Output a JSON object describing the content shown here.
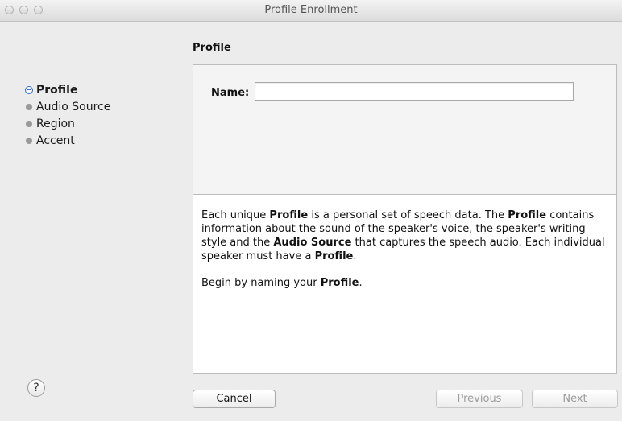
{
  "window": {
    "title": "Profile Enrollment"
  },
  "sidebar": {
    "steps": [
      {
        "label": "Profile",
        "state": "active"
      },
      {
        "label": "Audio Source",
        "state": "pending"
      },
      {
        "label": "Region",
        "state": "pending"
      },
      {
        "label": "Accent",
        "state": "pending"
      }
    ]
  },
  "main": {
    "section_title": "Profile",
    "name_label": "Name:",
    "name_value": "",
    "description": {
      "p1": [
        "Each unique ",
        "Profile",
        " is a personal set of speech data. The ",
        "Profile",
        " contains information about the sound of the speaker's voice, the speaker's writing style and the ",
        "Audio Source",
        " that captures the speech audio. Each individual speaker must have a ",
        "Profile",
        "."
      ],
      "p2": [
        "Begin by naming your ",
        "Profile",
        "."
      ]
    }
  },
  "footer": {
    "help_label": "?",
    "cancel_label": "Cancel",
    "previous_label": "Previous",
    "next_label": "Next"
  },
  "colors": {
    "accent": "#2b6ad6",
    "disabled_text": "#9b9b9b"
  }
}
